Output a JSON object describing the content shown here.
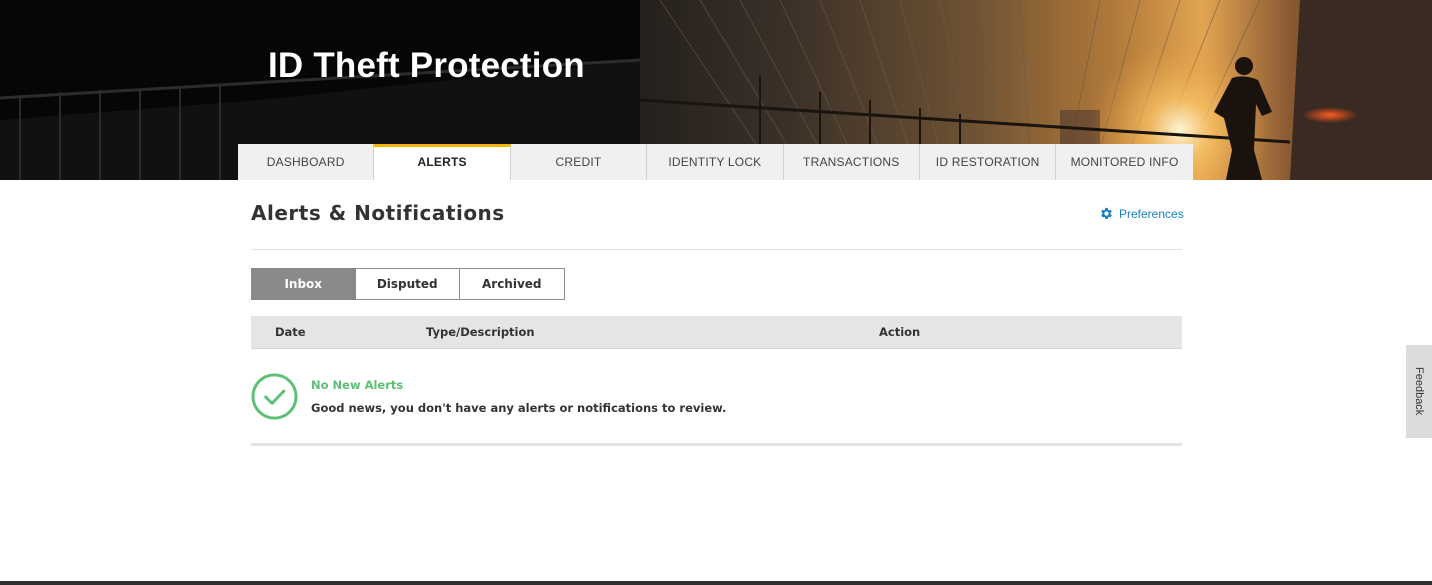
{
  "header": {
    "title": "ID Theft Protection"
  },
  "nav": {
    "tabs": [
      {
        "label": "DASHBOARD",
        "active": false
      },
      {
        "label": "ALERTS",
        "active": true
      },
      {
        "label": "CREDIT",
        "active": false
      },
      {
        "label": "IDENTITY LOCK",
        "active": false
      },
      {
        "label": "TRANSACTIONS",
        "active": false
      },
      {
        "label": "ID RESTORATION",
        "active": false
      },
      {
        "label": "MONITORED INFO",
        "active": false
      }
    ]
  },
  "main": {
    "title": "Alerts & Notifications",
    "preferences_label": "Preferences",
    "preferences_icon": "gear-icon",
    "segments": [
      {
        "label": "Inbox",
        "active": true
      },
      {
        "label": "Disputed",
        "active": false
      },
      {
        "label": "Archived",
        "active": false
      }
    ],
    "table": {
      "columns": [
        "Date",
        "Type/Description",
        "Action"
      ]
    },
    "empty_state": {
      "icon": "check-circle-icon",
      "title": "No New Alerts",
      "message": "Good news, you don't have any alerts or notifications to review."
    }
  },
  "feedback": {
    "label": "Feedback"
  },
  "colors": {
    "accent": "#f5b400",
    "link": "#1a7fc1",
    "success": "#5bbf74",
    "active_segment": "#8a8a8a"
  }
}
